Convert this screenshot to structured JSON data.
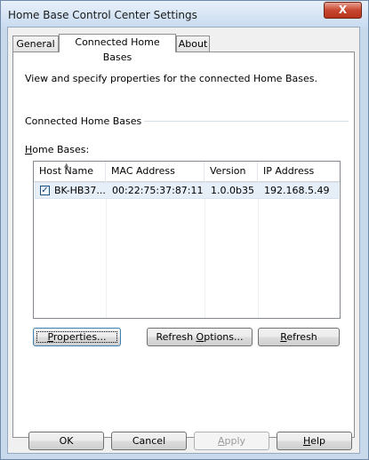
{
  "window": {
    "title": "Home Base Control Center Settings",
    "close_glyph": "X"
  },
  "tabs": [
    {
      "label": "General",
      "active": false
    },
    {
      "label": "Connected Home Bases",
      "active": true
    },
    {
      "label": "About",
      "active": false
    }
  ],
  "panel": {
    "description": "View and specify properties for the connected Home Bases.",
    "group_label": "Connected Home Bases",
    "list_label_accel": "H",
    "list_label_rest": "ome Bases:"
  },
  "listview": {
    "columns": [
      "Host Name",
      "MAC Address",
      "Version",
      "IP Address"
    ],
    "rows": [
      {
        "checked": true,
        "host": "BK-HB37...",
        "mac": "00:22:75:37:87:11",
        "version": "1.0.0b35",
        "ip": "192.168.5.49"
      }
    ]
  },
  "panel_buttons": {
    "properties_accel": "P",
    "properties_rest": "roperties...",
    "refresh_options_pre": "Refresh ",
    "refresh_options_accel": "O",
    "refresh_options_rest": "ptions...",
    "refresh_accel": "R",
    "refresh_rest": "efresh"
  },
  "dialog_buttons": {
    "ok": "OK",
    "cancel": "Cancel",
    "apply_accel": "A",
    "apply_rest": "pply",
    "help_accel": "H",
    "help_rest": "elp"
  },
  "colors": {
    "frame": "#c9d9ec",
    "close_button": "#c8462f",
    "selection": "#e6eef8"
  },
  "icons": {
    "close": "close-icon",
    "sort": "sort-ascending-icon",
    "checkbox": "checkbox-checked-icon"
  }
}
